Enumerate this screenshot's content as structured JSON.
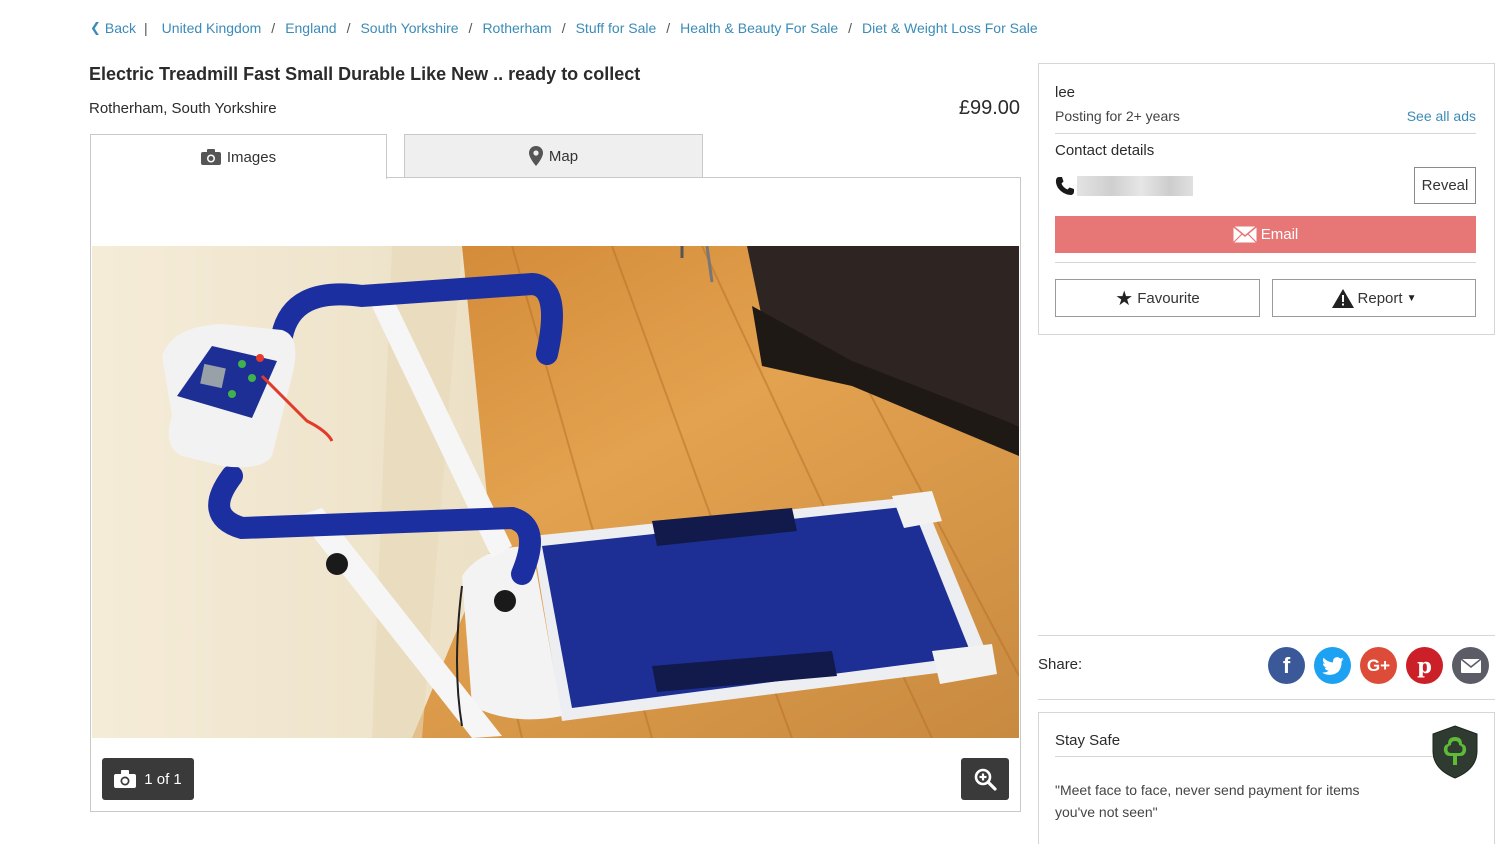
{
  "breadcrumb": {
    "back_label": "Back",
    "items": [
      "United Kingdom",
      "England",
      "South Yorkshire",
      "Rotherham",
      "Stuff for Sale",
      "Health & Beauty For Sale",
      "Diet & Weight Loss For Sale"
    ]
  },
  "listing": {
    "title": "Electric Treadmill Fast Small Durable Like New .. ready to collect",
    "location": "Rotherham, South Yorkshire",
    "price": "£99.00"
  },
  "tabs": {
    "images_label": "Images",
    "map_label": "Map",
    "active": "Images"
  },
  "gallery": {
    "counter": "1 of 1",
    "photo_icon": "camera-icon",
    "zoom_icon": "zoom-in-icon"
  },
  "seller": {
    "name": "lee",
    "posting_for": "Posting for 2+ years",
    "see_all_label": "See all ads",
    "contact_title": "Contact details",
    "reveal_label": "Reveal",
    "email_label": "Email",
    "favourite_label": "Favourite",
    "report_label": "Report"
  },
  "share": {
    "label": "Share:",
    "networks": [
      "facebook",
      "twitter",
      "google-plus",
      "pinterest",
      "email"
    ]
  },
  "stay_safe": {
    "title": "Stay Safe",
    "text": "\"Meet face to face, never send payment for items you've not seen\""
  },
  "colors": {
    "link": "#3b8bb6",
    "email_button": "#e77677",
    "facebook": "#3b5998",
    "twitter": "#1da1f2",
    "google_plus": "#dd4b39",
    "pinterest": "#cb2027",
    "mail": "#5c5c66"
  }
}
